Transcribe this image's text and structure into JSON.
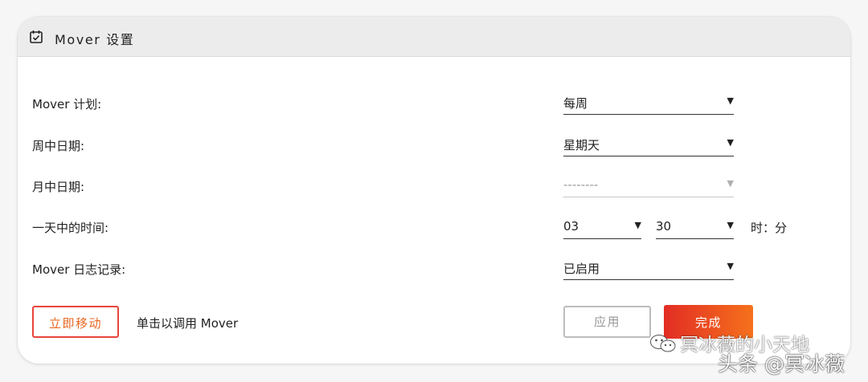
{
  "header": {
    "icon": "calendar-check-icon",
    "title": "Mover 设置"
  },
  "rows": {
    "schedule": {
      "label": "Mover 计划:",
      "value": "每周"
    },
    "day_of_week": {
      "label": "周中日期:",
      "value": "星期天"
    },
    "day_of_month": {
      "label": "月中日期:",
      "value": "--------",
      "disabled": true
    },
    "time_of_day": {
      "label": "一天中的时间:",
      "hour": "03",
      "minute": "30",
      "suffix": "时：分"
    },
    "logging": {
      "label": "Mover 日志记录:",
      "value": "已启用"
    }
  },
  "actions": {
    "move_now_label": "立即移动",
    "move_now_hint": "单击以调用 Mover",
    "apply_label": "应用",
    "done_label": "完成"
  },
  "watermark": {
    "line1": "冥冰薇的小天地",
    "line2": "头条 @冥冰薇",
    "icon": "wechat-icon"
  },
  "colors": {
    "accent_start": "#e22d24",
    "accent_end": "#f5711c",
    "header_bg": "#ececec"
  }
}
